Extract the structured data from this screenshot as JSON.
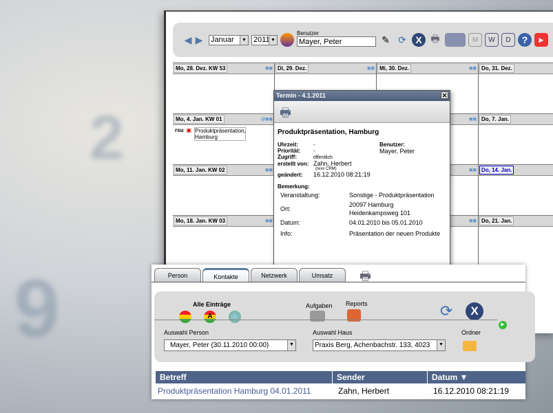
{
  "calendar": {
    "month": "Januar",
    "year": "2011",
    "user_label": "Benutzer",
    "user_value": "Mayer, Peter",
    "weeks": [
      {
        "days": [
          "Mo, 28. Dez. KW 53",
          "Di, 29. Dez.",
          "Mi, 30. Dez.",
          "Do, 31. Dez."
        ]
      },
      {
        "days": [
          "Mo, 4. Jan. KW 01",
          "",
          "",
          "Do, 7. Jan."
        ]
      },
      {
        "days": [
          "Mo, 11. Jan. KW 02",
          "",
          "",
          "Do, 14. Jan."
        ]
      },
      {
        "days": [
          "Mo, 18. Jan. KW 03",
          "",
          "",
          "Do, 21. Jan."
        ]
      }
    ],
    "event": {
      "user": "rsu",
      "title": "Produktpräsentation, Hamburg"
    }
  },
  "popup": {
    "title": "Termin - 4.1.2011",
    "heading": "Produktpräsentation, Hamburg",
    "uhrzeit_label": "Uhrzeit:",
    "uhrzeit": "-",
    "prioritaet_label": "Priorität:",
    "prioritaet": "-",
    "zugriff_label": "Zugriff:",
    "zugriff": "öffentlich",
    "erstellt_label": "erstellt von:",
    "erstellt": "Zahn, Herbert",
    "erstellt_sub": "(rexx CRM)",
    "geaendert_label": "geändert:",
    "geaendert": "16.12.2010  08:21:19",
    "benutzer_label": "Benutzer:",
    "benutzer": "Mayer, Peter",
    "bemerkung_label": "Bemerkung:",
    "details": [
      {
        "k": "Veranstaltung:",
        "v": "Sonstige - Produktpräsentation"
      },
      {
        "k": "Ort:",
        "v": "20097 Hamburg",
        "v2": "Heidenkampsweg 101"
      },
      {
        "k": "Datum:",
        "v": "04.01.2010 bis 05.01.2010"
      },
      {
        "k": "Info:",
        "v": "Präsentation der neuen Produkte"
      }
    ]
  },
  "contacts": {
    "tabs": [
      "Person",
      "Kontakte",
      "Netzwerk",
      "Umsatz"
    ],
    "alle": "Alle Einträge",
    "aufgaben": "Aufgaben",
    "reports": "Reports",
    "person_label": "Auswahl Person",
    "person_value": "Mayer, Peter   (30.11.2010 00:00)",
    "haus_label": "Auswahl Haus",
    "haus_value": "Praxis Berg, Achenbachstr. 133, 4023",
    "ordner": "Ordner",
    "columns": [
      "Betreff",
      "Sender",
      "Datum ▼"
    ],
    "rows": [
      [
        "Produktpräsentation Hamburg 04.01.2011",
        "Zahn, Herbert",
        "16.12.2010  08:21:19"
      ]
    ]
  }
}
